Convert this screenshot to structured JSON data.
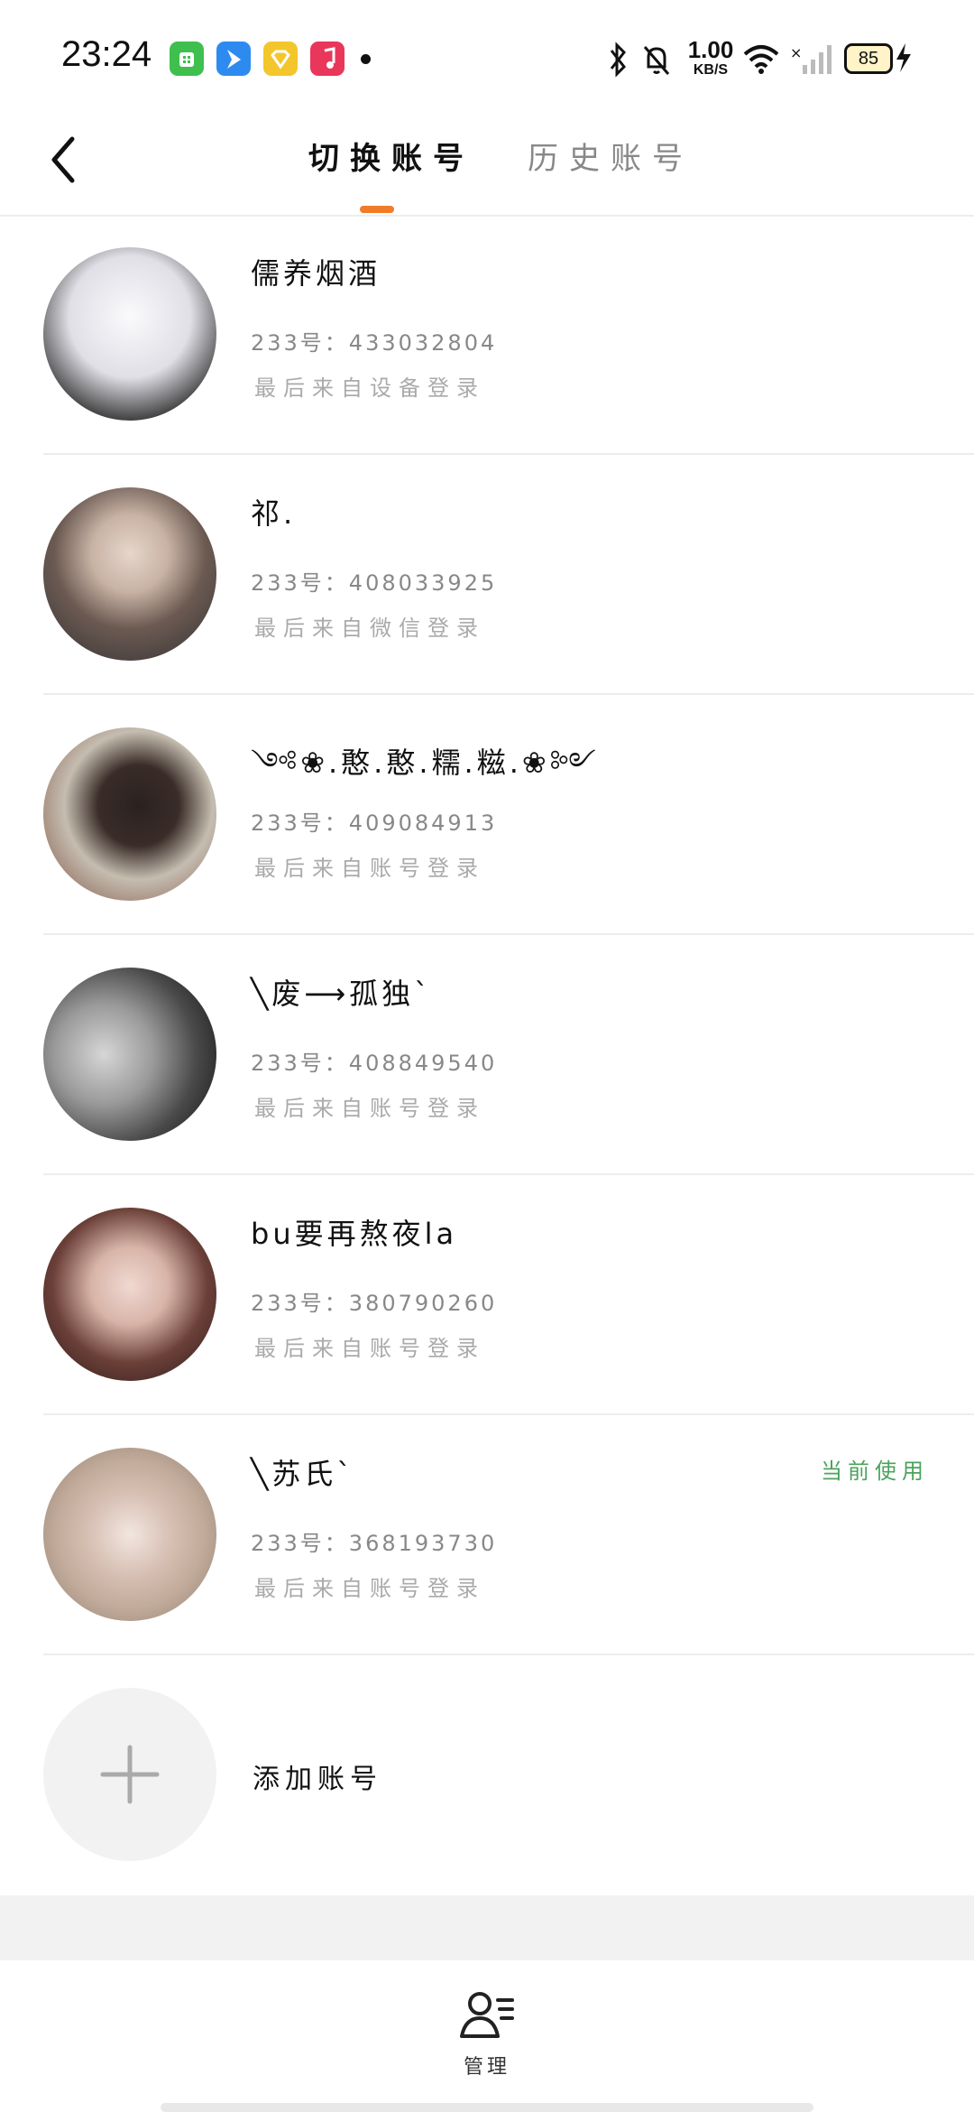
{
  "status_bar": {
    "time": "23:24",
    "net_speed_value": "1.00",
    "net_speed_unit": "KB/S",
    "battery": "85",
    "apps": [
      {
        "name": "app-store-icon",
        "color": "#3fbf4e"
      },
      {
        "name": "feishu-icon",
        "color": "#2d8bf0"
      },
      {
        "name": "gold-app-icon",
        "color": "#f3c62c"
      },
      {
        "name": "music-icon",
        "color": "#e8375a"
      }
    ]
  },
  "header": {
    "tabs": [
      {
        "label": "切换账号",
        "active": true
      },
      {
        "label": "历史账号",
        "active": false
      }
    ],
    "accent_color": "#f07c28"
  },
  "accounts": [
    {
      "name": "儒养烟酒",
      "id_line": "233号：433032804",
      "login": "最后来自设备登录",
      "current": false,
      "avatar_colors": [
        "#f1f1f4",
        "#d8d8e0",
        "#2b2b2b"
      ]
    },
    {
      "name": "祁.",
      "id_line": "233号：408033925",
      "login": "最后来自微信登录",
      "current": false,
      "avatar_colors": [
        "#3a3638",
        "#cbb6a8",
        "#5a4b44"
      ]
    },
    {
      "name": "༺❀.憨.憨.糯.糍.❀༻",
      "id_line": "233号：409084913",
      "login": "最后来自账号登录",
      "current": false,
      "avatar_colors": [
        "#6e4a3e",
        "#cfc7b8",
        "#2b2421"
      ]
    },
    {
      "name": "╲废⟶孤独`",
      "id_line": "233号：408849540",
      "login": "最后来自账号登录",
      "current": false,
      "avatar_colors": [
        "#1a1a1a",
        "#c9c9c9",
        "#6a6a6a"
      ]
    },
    {
      "name": "bu要再熬夜la",
      "id_line": "233号：380790260",
      "login": "最后来自账号登录",
      "current": false,
      "avatar_colors": [
        "#5a3a34",
        "#e9cfc6",
        "#2c1c1a"
      ]
    },
    {
      "name": "╲苏氏`",
      "id_line": "233号：368193730",
      "login": "最后来自账号登录",
      "current": true,
      "current_label": "当前使用",
      "avatar_colors": [
        "#e3d9cf",
        "#c8a89a",
        "#9d8a80"
      ]
    }
  ],
  "add_account": {
    "label": "添加账号"
  },
  "bottom_bar": {
    "manage_label": "管理"
  }
}
